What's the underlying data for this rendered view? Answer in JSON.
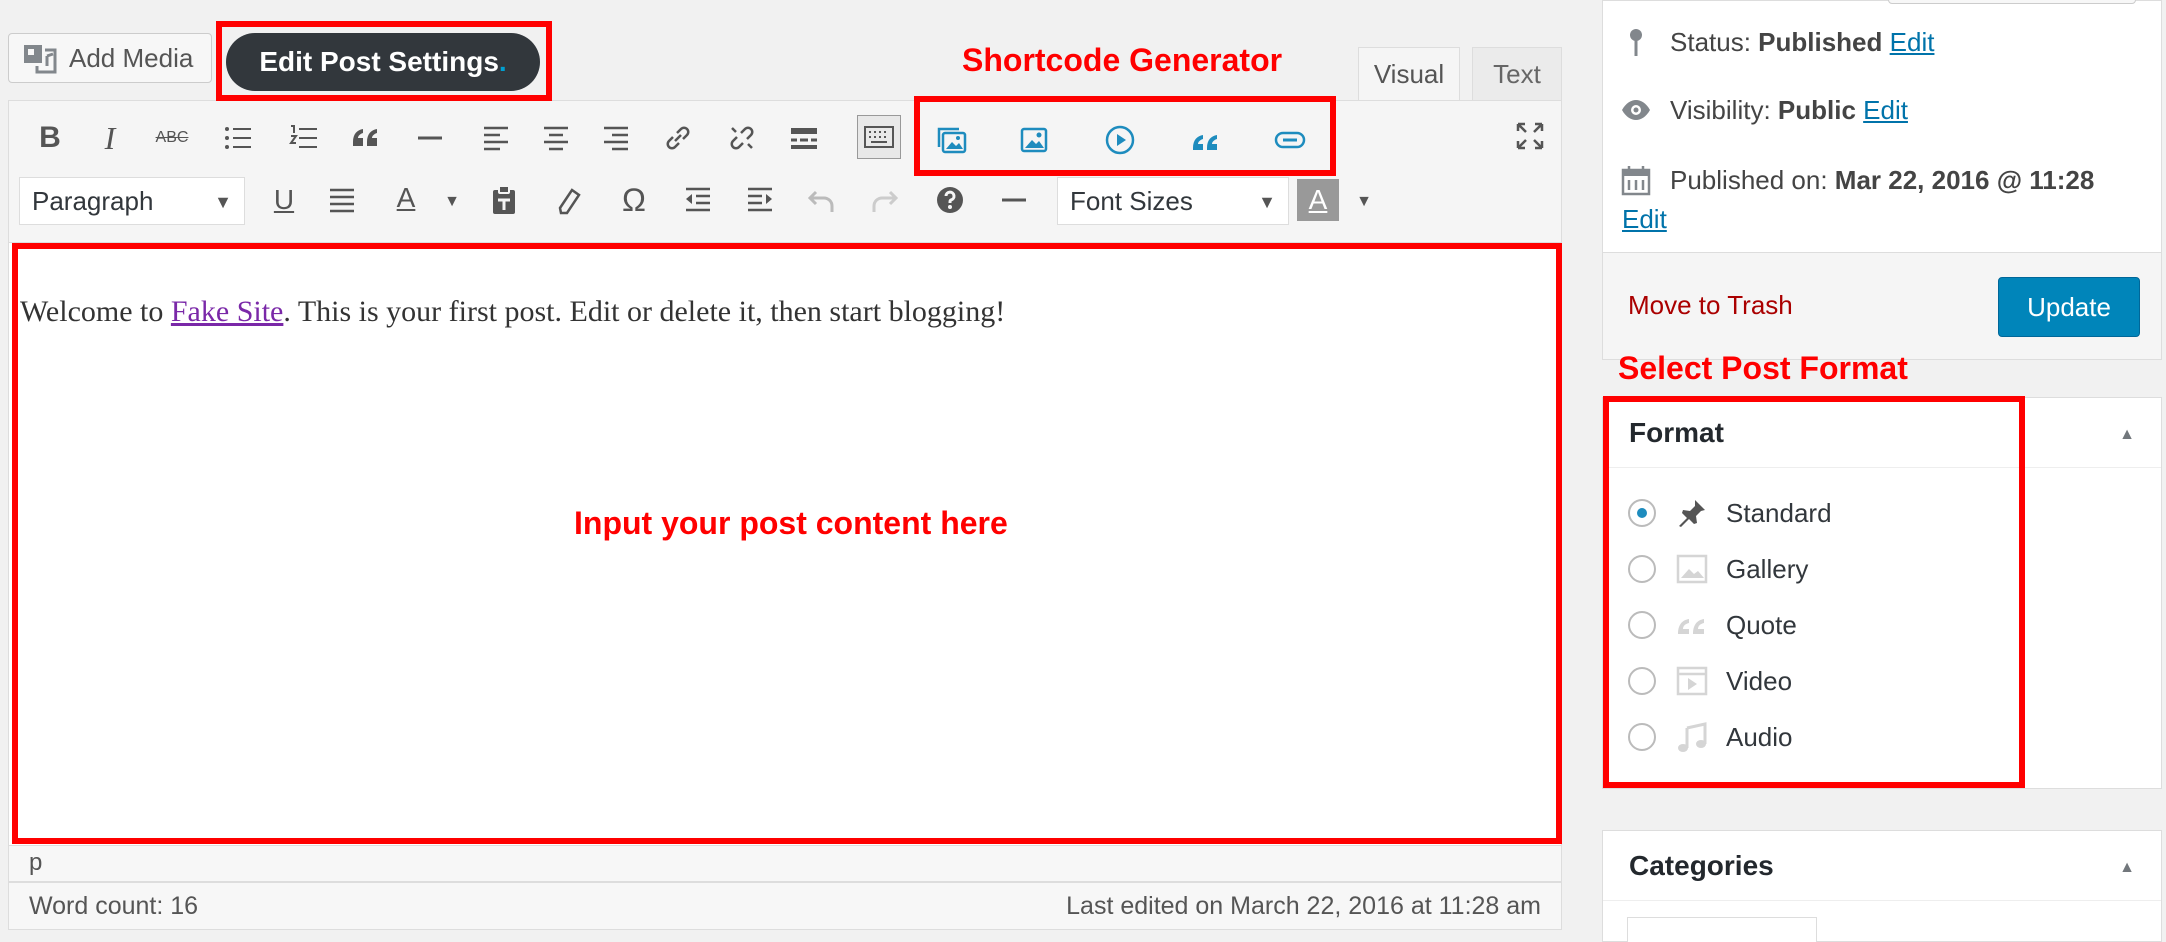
{
  "top": {
    "add_media_label": "Add Media",
    "edit_post_settings_label": "Edit Post Settings",
    "edit_post_settings_dot": ".",
    "tabs": [
      {
        "label": "Visual"
      },
      {
        "label": "Text"
      }
    ]
  },
  "toolbar": {
    "paragraph_select": "Paragraph",
    "font_sizes_select": "Font Sizes",
    "omega_glyph": "Ω",
    "row1_icons": [
      "bold-icon",
      "italic-icon",
      "strikethrough-icon",
      "bullet-list-icon",
      "numbered-list-icon",
      "blockquote-icon",
      "horizontal-line-icon",
      "align-left-icon",
      "align-center-icon",
      "align-right-icon",
      "link-icon",
      "unlink-icon",
      "read-more-icon",
      "toolbar-toggle-icon"
    ],
    "shortcode_icons": [
      "gallery-shortcode-icon",
      "image-shortcode-icon",
      "video-shortcode-icon",
      "quote-shortcode-icon",
      "button-shortcode-icon"
    ],
    "bold_glyph": "B",
    "italic_glyph": "I",
    "strike_glyph": "ABC",
    "underline_glyph": "U",
    "textcolor_glyph": "A",
    "bgcolor_glyph": "A"
  },
  "editor": {
    "text_before": "Welcome to ",
    "link_text": "Fake Site",
    "text_after": ". This is your first post. Edit or delete it, then start blogging!",
    "path": "p",
    "word_count": "Word count: 16",
    "last_edited": "Last edited on March 22, 2016 at 11:28 am"
  },
  "publish": {
    "status_label": "Status: ",
    "status_value": "Published",
    "visibility_label": "Visibility: ",
    "visibility_value": "Public",
    "published_on_label": "Published on: ",
    "published_on_value": "Mar 22, 2016 @ 11:28",
    "edit_link": "Edit",
    "move_to_trash": "Move to Trash",
    "update_label": "Update"
  },
  "format_box": {
    "title": "Format",
    "options": [
      {
        "label": "Standard",
        "checked": true,
        "icon": "pin-icon"
      },
      {
        "label": "Gallery",
        "checked": false,
        "icon": "gallery-icon"
      },
      {
        "label": "Quote",
        "checked": false,
        "icon": "quote-icon"
      },
      {
        "label": "Video",
        "checked": false,
        "icon": "video-icon"
      },
      {
        "label": "Audio",
        "checked": false,
        "icon": "audio-icon"
      }
    ]
  },
  "categories_box": {
    "title": "Categories"
  },
  "annotations": {
    "shortcode_generator": "Shortcode Generator",
    "select_post_format": "Select Post Format",
    "input_content": "Input your post content here"
  },
  "colors": {
    "accent": "#0085ba",
    "annotation": "#ff0000",
    "link": "#0073aa"
  }
}
